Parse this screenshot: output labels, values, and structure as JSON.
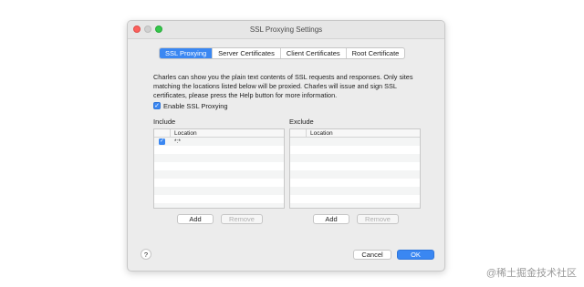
{
  "window": {
    "title": "SSL Proxying Settings"
  },
  "tabs": [
    {
      "label": "SSL Proxying",
      "active": true
    },
    {
      "label": "Server Certificates",
      "active": false
    },
    {
      "label": "Client Certificates",
      "active": false
    },
    {
      "label": "Root Certificate",
      "active": false
    }
  ],
  "description": "Charles can show you the plain text contents of SSL requests and responses. Only sites matching the locations listed below will be proxied. Charles will issue and sign SSL certificates, please press the Help button for more information.",
  "enable": {
    "label": "Enable SSL Proxying",
    "checked": true,
    "check_glyph": "✓"
  },
  "include": {
    "label": "Include",
    "column": "Location",
    "rows": [
      {
        "checked": true,
        "check_glyph": "✓",
        "location": "*:*"
      }
    ],
    "add_label": "Add",
    "remove_label": "Remove"
  },
  "exclude": {
    "label": "Exclude",
    "column": "Location",
    "rows": [],
    "add_label": "Add",
    "remove_label": "Remove"
  },
  "footer": {
    "help_label": "?",
    "cancel_label": "Cancel",
    "ok_label": "OK"
  },
  "watermark": "@稀土掘金技术社区",
  "colors": {
    "accent": "#3a87f2",
    "close": "#fc605c",
    "zoom": "#34c84a"
  }
}
